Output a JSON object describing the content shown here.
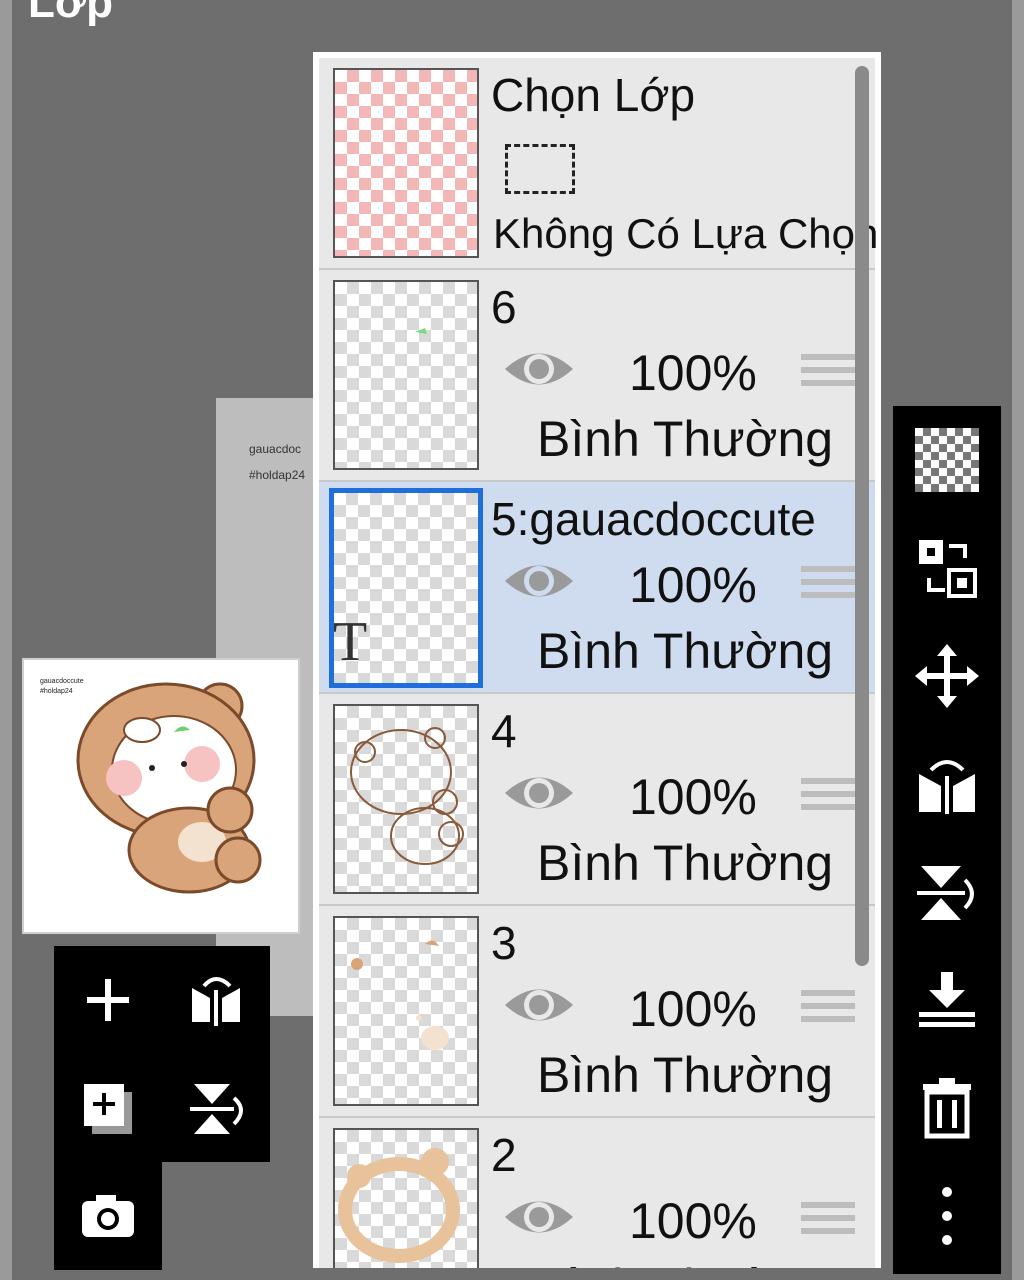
{
  "header": {
    "title": "Lớp"
  },
  "canvas": {
    "text1": "gauacdoc",
    "text2": "#holdap24"
  },
  "preview": {
    "text1": "gauacdoccute",
    "text2": "#holdap24"
  },
  "selection": {
    "title": "Chọn Lớp",
    "status": "Không Có Lựa Chọn"
  },
  "layers": [
    {
      "name": "6",
      "opacity": "100%",
      "blend": "Bình Thường",
      "selected": false,
      "text_layer": false
    },
    {
      "name": "5:gauacdoccute",
      "opacity": "100%",
      "blend": "Bình Thường",
      "selected": true,
      "text_layer": true,
      "badge": "T"
    },
    {
      "name": "4",
      "opacity": "100%",
      "blend": "Bình Thường",
      "selected": false,
      "text_layer": false
    },
    {
      "name": "3",
      "opacity": "100%",
      "blend": "Bình Thường",
      "selected": false,
      "text_layer": false
    },
    {
      "name": "2",
      "opacity": "100%",
      "blend": "Bình Thường",
      "selected": false,
      "text_layer": false
    }
  ],
  "left_tools": [
    "add-layer-icon",
    "flip-horizontal-icon",
    "add-copy-icon",
    "flip-vertical-icon",
    "camera-icon"
  ],
  "right_tools": [
    "transparency-icon",
    "swap-layers-icon",
    "move-icon",
    "flip-horizontal-icon",
    "flip-vertical-icon",
    "merge-down-icon",
    "delete-icon",
    "more-icon"
  ],
  "colors": {
    "selected_row": "#cfdcef",
    "selected_border": "#1e6fd9",
    "toolbar": "#000000"
  }
}
